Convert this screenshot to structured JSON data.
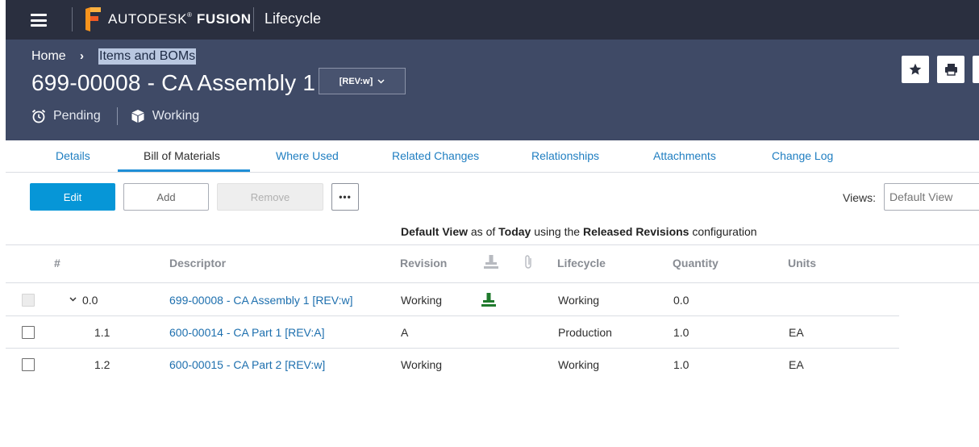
{
  "topbar": {
    "brand_name": "AUTODESK",
    "brand_product": "FUSION",
    "brand_mark": "®",
    "app_name": "Lifecycle",
    "menu_icon": "hamburger-icon",
    "logo_icon": "fusion-logo-icon"
  },
  "breadcrumb": {
    "home": "Home",
    "separator_icon": "chevron-right-icon",
    "current": "Items and BOMs"
  },
  "item": {
    "title": "699-00008 - CA Assembly 1",
    "revision_label": "[REV:w]",
    "status": "Pending",
    "state": "Working",
    "status_icon": "alarm-clock-icon",
    "state_icon": "cube-icon"
  },
  "header_actions": {
    "favorite_icon": "star-icon",
    "print_icon": "printer-icon"
  },
  "tabs": [
    {
      "label": "Details"
    },
    {
      "label": "Bill of Materials"
    },
    {
      "label": "Where Used"
    },
    {
      "label": "Related Changes"
    },
    {
      "label": "Relationships"
    },
    {
      "label": "Attachments"
    },
    {
      "label": "Change Log"
    }
  ],
  "active_tab": "Bill of Materials",
  "toolbar": {
    "edit_label": "Edit",
    "add_label": "Add",
    "remove_label": "Remove",
    "more_label": "•••",
    "views_label": "Views:",
    "views_placeholder": "Default View"
  },
  "config_line": {
    "view": "Default View",
    "as_of": "as of",
    "date": "Today",
    "using": "using the",
    "configuration": "Released Revisions",
    "suffix": "configuration"
  },
  "columns": {
    "num": "#",
    "descriptor": "Descriptor",
    "revision": "Revision",
    "pin_icon": "pin-icon",
    "attachment_icon": "paperclip-icon",
    "lifecycle": "Lifecycle",
    "quantity": "Quantity",
    "units": "Units"
  },
  "rows": [
    {
      "num": "0.0",
      "descriptor": "699-00008 - CA Assembly 1 [REV:w]",
      "revision": "Working",
      "lifecycle": "Working",
      "quantity": "0.0",
      "units": "",
      "pinned": true
    },
    {
      "num": "1.1",
      "descriptor": "600-00014 - CA Part 1 [REV:A]",
      "revision": "A",
      "lifecycle": "Production",
      "quantity": "1.0",
      "units": "EA",
      "pinned": false
    },
    {
      "num": "1.2",
      "descriptor": "600-00015 - CA Part 2 [REV:w]",
      "revision": "Working",
      "lifecycle": "Working",
      "quantity": "1.0",
      "units": "EA",
      "pinned": false
    }
  ],
  "colors": {
    "topbar": "#2a2f3f",
    "header": "#3f4a66",
    "accent": "#0696d7",
    "link": "#1d6fae",
    "pin_green": "#1f7a2c"
  }
}
